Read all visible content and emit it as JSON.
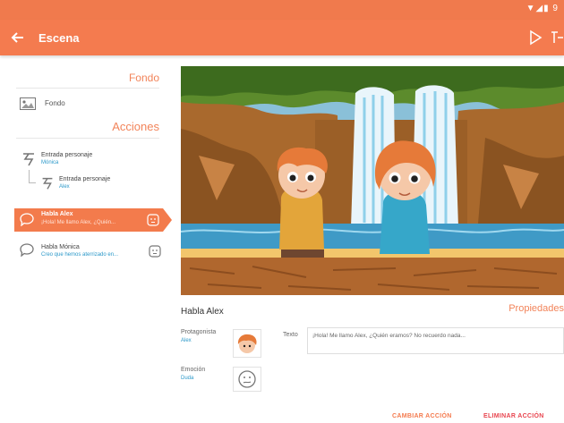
{
  "statusbar": {
    "icons": "▼◢▮ 9"
  },
  "appbar": {
    "title": "Escena",
    "back_icon": "back-arrow-icon",
    "play_icon": "play-icon",
    "extra_icon": "extra-icon"
  },
  "left": {
    "fondo_header": "Fondo",
    "fondo_item": "Fondo",
    "acciones_header": "Acciones",
    "actions": [
      {
        "title": "Entrada personaje",
        "subtitle": "Mónica"
      },
      {
        "title": "Entrada personaje",
        "subtitle": "Alex"
      },
      {
        "title": "Habla Alex",
        "subtitle": "¡Hola! Me llamo Alex, ¿Quién..."
      },
      {
        "title": "Habla Mónica",
        "subtitle": "Creo que hemos aterrizado en..."
      }
    ]
  },
  "properties": {
    "speaker_title": "Habla Alex",
    "header": "Propiedades",
    "protagonist_label": "Protagonista",
    "protagonist_value": "Alex",
    "emotion_label": "Emoción",
    "emotion_value": "Duda",
    "text_label": "Texto",
    "text_value": "¡Hola! Me llamo Alex, ¿Quién eramos? No recuerdo nada..."
  },
  "buttons": {
    "change_action": "CAMBIAR ACCIÓN",
    "delete_action": "ELIMINAR ACCIÓN"
  },
  "colors": {
    "accent": "#f47b4f",
    "link": "#2b98c9",
    "delete": "#e8454f"
  }
}
